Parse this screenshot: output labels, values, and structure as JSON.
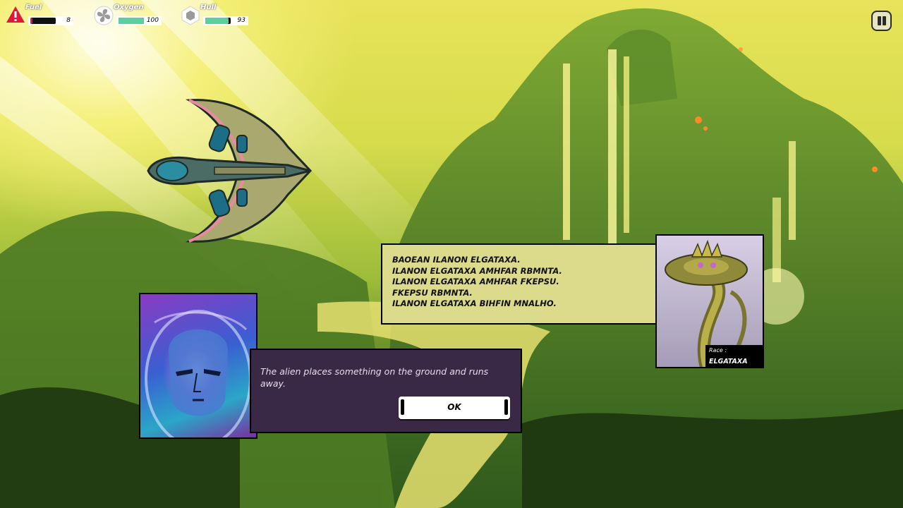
{
  "hud": {
    "fuel": {
      "label": "Fuel",
      "value": "8",
      "level": 0.08,
      "color": "#e0163e"
    },
    "oxygen": {
      "label": "Oxygen",
      "value": "100",
      "level": 1.0,
      "color": "#5ad0a0"
    },
    "hull": {
      "label": "Hull",
      "value": "93",
      "level": 0.93,
      "color": "#5ad0a0"
    }
  },
  "icons": {
    "fuel": "warning-triangle-icon",
    "oxygen": "fan-icon",
    "hull": "hexagon-shield-icon",
    "pause": "pause-icon"
  },
  "alien_dialog": {
    "lines": [
      "BAOEAN ILANON ELGATAXA.",
      "ILANON ELGATAXA AMHFAR RBMNTA.",
      "ILANON ELGATAXA AMHFAR FKEPSU.",
      "FKEPSU RBMNTA.",
      "ILANON ELGATAXA BIHFIN MNALHO."
    ]
  },
  "alien": {
    "race_label": "Race :",
    "race_name": "ELGATAXA"
  },
  "story": {
    "text": "The alien places something on the ground and runs away.",
    "ok_label": "OK"
  },
  "colors": {
    "alien_dialog_bg": "#dcdb8c",
    "story_bg": "#3a2946",
    "accent_red": "#e0163e",
    "accent_green": "#5ad0a0"
  }
}
